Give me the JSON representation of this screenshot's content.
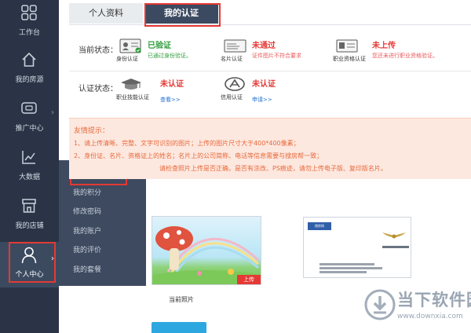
{
  "sidebar": {
    "items": [
      {
        "label": "工作台",
        "icon": "grid-icon"
      },
      {
        "label": "我的房源",
        "icon": "house-icon"
      },
      {
        "label": "推广中心",
        "icon": "screen-icon"
      },
      {
        "label": "大数据",
        "icon": "chart-icon"
      },
      {
        "label": "我的店铺",
        "icon": "store-icon"
      },
      {
        "label": "个人中心",
        "icon": "user-icon"
      }
    ],
    "submenu": [
      {
        "label": "我的资料/认证"
      },
      {
        "label": "我的积分"
      },
      {
        "label": "修改密码"
      },
      {
        "label": "我的账户"
      },
      {
        "label": "我的评价"
      },
      {
        "label": "我的套餐"
      }
    ]
  },
  "tabs": {
    "profile": "个人资料",
    "cert": "我的认证"
  },
  "status": {
    "current_label": "当前状态：",
    "cert_label": "认证状态：",
    "items": [
      {
        "caption": "身份认证",
        "status": "已验证",
        "note": "已通过身份验证。"
      },
      {
        "caption": "名片认证",
        "status": "未通过",
        "note": "证件图片不符合要求"
      },
      {
        "caption": "职业资格认证",
        "status": "未上传",
        "note": "您还未进行职业资格验证。"
      },
      {
        "caption": "职业技能认证",
        "status": "未认证",
        "note": "查看>>"
      },
      {
        "caption": "信用认证",
        "status": "未认证",
        "note": "申请>>"
      }
    ]
  },
  "tips": {
    "title": "友情提示：",
    "lines": [
      "1、请上传清晰、完整、文字可识别的图片；上传的图片尺寸大于400*400像素；",
      "2、身份证、名片、资格证上的姓名；名片上的公司简称、电话等信息需要与搜房帮一致；",
      "请检查照片上传是否正确，是否有涂改、PS痕迹，请勿上传电子版、复印版名片。"
    ]
  },
  "samples": {
    "photo_caption": "当前照片",
    "upload_label": "上传",
    "card_badge": "搜房网"
  },
  "watermark": {
    "brand": "当下软件园",
    "url": "www.downxia.com"
  },
  "colors": {
    "sidebar_bg": "#2a3446",
    "submenu_bg": "#3d4a5f",
    "accent_red": "#e53935",
    "verified_green": "#2e9d3a",
    "link_blue": "#1f6fd1",
    "tips_bg": "#fde8e0"
  }
}
